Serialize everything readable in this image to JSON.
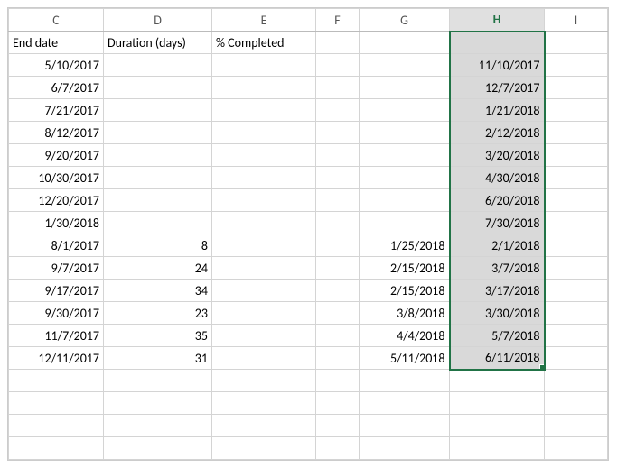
{
  "columns": [
    "C",
    "D",
    "E",
    "F",
    "G",
    "H",
    "I"
  ],
  "active_column": "H",
  "headers": {
    "C": "End date",
    "D": "Duration (days)",
    "E": "% Completed",
    "F": "",
    "G": "",
    "H": "",
    "I": ""
  },
  "rows": [
    {
      "C": "5/10/2017",
      "D": "",
      "E": "",
      "F": "",
      "G": "",
      "H": "11/10/2017"
    },
    {
      "C": "6/7/2017",
      "D": "",
      "E": "",
      "F": "",
      "G": "",
      "H": "12/7/2017"
    },
    {
      "C": "7/21/2017",
      "D": "",
      "E": "",
      "F": "",
      "G": "",
      "H": "1/21/2018"
    },
    {
      "C": "8/12/2017",
      "D": "",
      "E": "",
      "F": "",
      "G": "",
      "H": "2/12/2018"
    },
    {
      "C": "9/20/2017",
      "D": "",
      "E": "",
      "F": "",
      "G": "",
      "H": "3/20/2018"
    },
    {
      "C": "10/30/2017",
      "D": "",
      "E": "",
      "F": "",
      "G": "",
      "H": "4/30/2018"
    },
    {
      "C": "12/20/2017",
      "D": "",
      "E": "",
      "F": "",
      "G": "",
      "H": "6/20/2018"
    },
    {
      "C": "1/30/2018",
      "D": "",
      "E": "",
      "F": "",
      "G": "",
      "H": "7/30/2018"
    },
    {
      "C": "8/1/2017",
      "D": "8",
      "E": "",
      "F": "",
      "G": "1/25/2018",
      "H": "2/1/2018"
    },
    {
      "C": "9/7/2017",
      "D": "24",
      "E": "",
      "F": "",
      "G": "2/15/2018",
      "H": "3/7/2018"
    },
    {
      "C": "9/17/2017",
      "D": "34",
      "E": "",
      "F": "",
      "G": "2/15/2018",
      "H": "3/17/2018"
    },
    {
      "C": "9/30/2017",
      "D": "23",
      "E": "",
      "F": "",
      "G": "3/8/2018",
      "H": "3/30/2018"
    },
    {
      "C": "11/7/2017",
      "D": "35",
      "E": "",
      "F": "",
      "G": "4/4/2018",
      "H": "5/7/2018"
    },
    {
      "C": "12/11/2017",
      "D": "31",
      "E": "",
      "F": "",
      "G": "5/11/2018",
      "H": "6/11/2018"
    },
    {
      "C": "",
      "D": "",
      "E": "",
      "F": "",
      "G": "",
      "H": ""
    },
    {
      "C": "",
      "D": "",
      "E": "",
      "F": "",
      "G": "",
      "H": ""
    },
    {
      "C": "",
      "D": "",
      "E": "",
      "F": "",
      "G": "",
      "H": ""
    },
    {
      "C": "",
      "D": "",
      "E": "",
      "F": "",
      "G": "",
      "H": ""
    }
  ],
  "selection": {
    "col": "H",
    "row_start": 0,
    "row_end": 13
  }
}
